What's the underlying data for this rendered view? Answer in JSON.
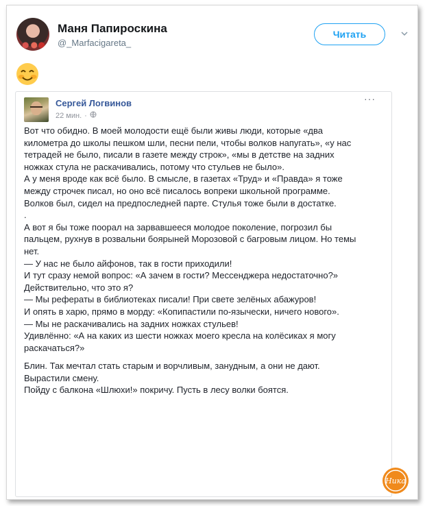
{
  "tweet": {
    "author_name": "Маня Папироскина",
    "author_handle": "@_Marfacigareta_",
    "follow_label": "Читать",
    "emoji": "smiling-face-with-blush"
  },
  "embedded_post": {
    "author_name": "Сергей Логвинов",
    "time": "22 мин.",
    "paragraphs": [
      "Вот что обидно. В моей молодости ещё были живы люди, которые «два километра до школы пешком шли, песни пели, чтобы волков напугать», «у нас тетрадей не было, писали в газете между строк», «мы в детстве на задних ножках стула не раскачивались, потому что стульев не было».",
      "А у меня вроде как всё было. В смысле, в газетах «Труд» и «Правда» я тоже между строчек писал, но оно всё писалось вопреки школьной программе. Волков был, сидел на предпоследней парте. Стулья тоже были в достатке.",
      ".",
      "А вот я бы тоже поорал на зарвавшееся молодое поколение, погрозил бы пальцем, рухнув в розвальни боярыней Морозовой с багровым лицом. Но темы нет.",
      "— У нас не было айфонов, так в гости приходили!",
      "И тут сразу немой вопрос: «А зачем в гости? Мессенджера недостаточно?»",
      "Действительно, что это я?",
      "— Мы рефераты в библиотеках писали! При свете зелёных абажуров!",
      "И опять в харю, прямо в морду: «Копипастили по-язычески, ничего нового».",
      "— Мы не раскачивались на задних ножках стульев!",
      "Удивлённо: «А на каких из шести ножках моего кресла на колёсиках я могу раскачаться?»",
      "Блин. Так мечтал стать старым и ворчливым, занудным, а они не дают. Вырастили смену.",
      "Пойду с балкона «Шлюхи!» покричу. Пусть в лесу волки боятся."
    ],
    "more_label": "···"
  },
  "watermark": {
    "text": "Ника"
  },
  "colors": {
    "twitter_blue": "#1da1f2",
    "facebook_name": "#365899",
    "watermark_orange": "#f08a1c"
  }
}
